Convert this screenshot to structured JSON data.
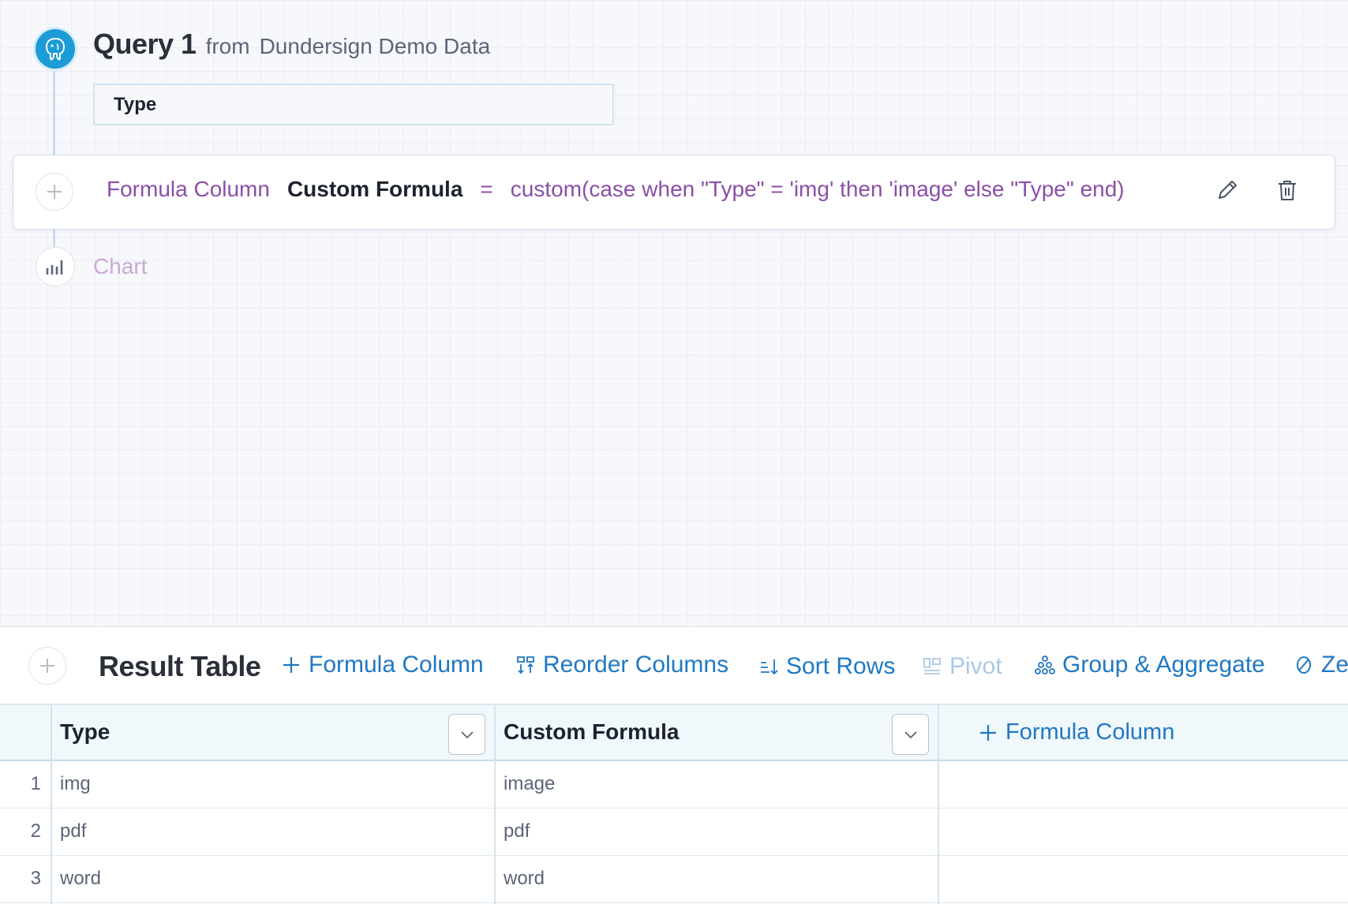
{
  "query": {
    "name": "Query 1",
    "from_label": "from",
    "source": "Dundersign Demo Data",
    "selected_column": "Type"
  },
  "formula_step": {
    "type_label": "Formula Column",
    "column_name": "Custom Formula",
    "equals": "=",
    "expression": "custom(case when \"Type\" = 'img' then 'image' else \"Type\" end)"
  },
  "chart_step": {
    "label": "Chart"
  },
  "result_toolbar": {
    "title": "Result Table",
    "formula_column": "Formula Column",
    "reorder_columns": "Reorder Columns",
    "sort_rows": "Sort Rows",
    "pivot": "Pivot",
    "group_aggregate": "Group & Aggregate",
    "next_truncated": "Ze"
  },
  "table": {
    "columns": [
      "Type",
      "Custom Formula"
    ],
    "add_column_label": "Formula Column",
    "rows": [
      {
        "num": "1",
        "type": "img",
        "custom": "image"
      },
      {
        "num": "2",
        "type": "pdf",
        "custom": "pdf"
      },
      {
        "num": "3",
        "type": "word",
        "custom": "word"
      }
    ]
  },
  "colors": {
    "accent_blue": "#1f78c4",
    "formula_purple": "#8b4fa8",
    "postgres_blue": "#1c9bd6"
  },
  "icons": [
    "postgres-icon",
    "plus-icon",
    "pencil-icon",
    "trash-icon",
    "bar-chart-icon",
    "reorder-icon",
    "sort-icon",
    "pivot-icon",
    "group-icon",
    "zero-icon",
    "chevron-down-icon"
  ]
}
